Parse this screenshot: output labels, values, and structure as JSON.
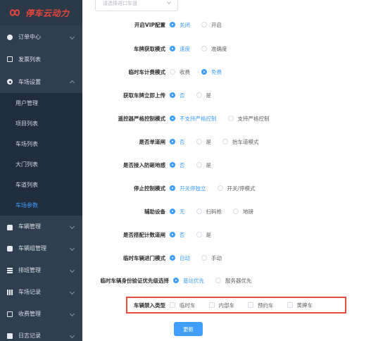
{
  "logo": {
    "title": "停车云动力"
  },
  "sidebar": {
    "items": [
      {
        "label": "订单中心",
        "icon": "order-icon"
      },
      {
        "label": "发票列表",
        "icon": "invoice-icon"
      },
      {
        "label": "车场设置",
        "icon": "gear-icon"
      }
    ],
    "sub_items": [
      "用户管理",
      "项目列表",
      "车场列表",
      "大门列表",
      "车道列表",
      "车场参数"
    ],
    "bottom_items": [
      {
        "label": "车辆管理",
        "icon": "car-icon"
      },
      {
        "label": "车辆组管理",
        "icon": "car-group-icon"
      },
      {
        "label": "排班管理",
        "icon": "schedule-icon"
      },
      {
        "label": "车场记录",
        "icon": "chart-icon"
      },
      {
        "label": "收费管理",
        "icon": "phone-icon"
      },
      {
        "label": "日志记录",
        "icon": "log-icon"
      }
    ]
  },
  "lane_select": {
    "placeholder": "请选择进口车道"
  },
  "form": {
    "rows": [
      {
        "label": "开启VIP配置",
        "options": [
          "关闭",
          "开启"
        ],
        "selected": 0
      },
      {
        "label": "车牌获取模式",
        "options": [
          "速度",
          "准确度"
        ],
        "selected": 0
      },
      {
        "label": "临时车计费模式",
        "options": [
          "收费",
          "免费"
        ],
        "selected": 1
      },
      {
        "label": "获取车牌立即上传",
        "options": [
          "否",
          "是"
        ],
        "selected": 0
      },
      {
        "label": "遥控器严格控制模式",
        "options": [
          "不支持严格控制",
          "支持严格控制"
        ],
        "selected": 0
      },
      {
        "label": "是否单道闸",
        "options": [
          "否",
          "是",
          "抬车道模式"
        ],
        "selected": 0
      },
      {
        "label": "是否接入防砸地感",
        "options": [
          "否",
          "是"
        ],
        "selected": 0
      },
      {
        "label": "停止控制模式",
        "options": [
          "开关停独立",
          "开关/停模式"
        ],
        "selected": 0
      },
      {
        "label": "辅助设备",
        "options": [
          "无",
          "扫码枪",
          "地磅"
        ],
        "selected": 0
      },
      {
        "label": "是否搭配计数道闸",
        "options": [
          "否",
          "是"
        ],
        "selected": 0
      },
      {
        "label": "临时车辆进门模式",
        "options": [
          "自动",
          "手动"
        ],
        "selected": 0
      },
      {
        "label": "临时车辆身份验证优先级选择",
        "options": [
          "基站优先",
          "服务器优先"
        ],
        "selected": 0
      }
    ],
    "forbidden": {
      "label": "车辆禁入类型",
      "options": [
        "临时车",
        "内部车",
        "预约车",
        "黄牌车"
      ]
    },
    "submit_label": "更新"
  },
  "colors": {
    "primary": "#409eff",
    "sidebar_bg": "#2f3e51",
    "submenu_bg": "#1f2d3d",
    "highlight_border": "#e74c3c",
    "logo": "#e8443a"
  }
}
